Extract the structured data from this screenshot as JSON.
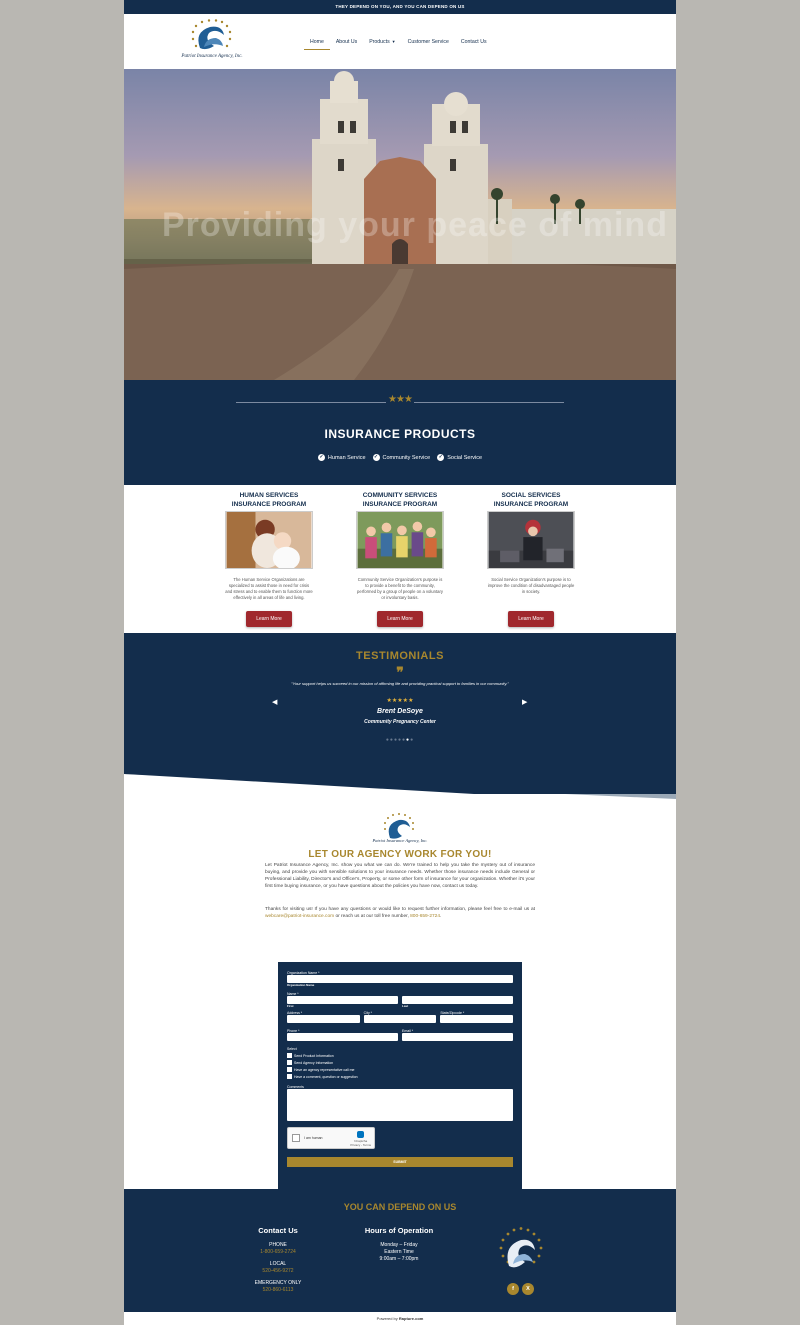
{
  "topbar": {
    "text": "THEY DEPEND ON YOU, AND YOU CAN DEPEND ON US"
  },
  "brand": {
    "name": "Patriot Insurance Agency, Inc."
  },
  "nav": {
    "items": [
      {
        "label": "Home"
      },
      {
        "label": "About Us"
      },
      {
        "label": "Products"
      },
      {
        "label": "Customer Service"
      },
      {
        "label": "Contact Us"
      }
    ],
    "active": "Home"
  },
  "hero": {
    "tagline": "Providing your peace of mind"
  },
  "products_band": {
    "title": "INSURANCE PRODUCTS",
    "checks": [
      "Human Service",
      "Community Service",
      "Social Service"
    ]
  },
  "cards": [
    {
      "title_1": "HUMAN SERVICES",
      "title_2": "INSURANCE PROGRAM",
      "desc": "The Human Service Organizations are specialized to assist those in need for crisis and stress and to enable them to function more effectively in all areas of life and living.",
      "button": "Learn More"
    },
    {
      "title_1": "COMMUNITY SERVICES",
      "title_2": "INSURANCE PROGRAM",
      "desc": "Community Service Organization's purpose is to provide a benefit to the community, performed by a group of people on a voluntary or involuntary basis.",
      "button": "Learn More"
    },
    {
      "title_1": "SOCIAL SERVICES",
      "title_2": "INSURANCE PROGRAM",
      "desc": "Social Service Organization's purpose is to improve the condition of disadvantaged people in society.",
      "button": "Learn More"
    }
  ],
  "testimonials": {
    "title": "TESTIMONIALS",
    "quote": "\"Your support helps us succeed in our mission of affirming life and providing practical support to families in our community.\"",
    "stars": "★★★★★",
    "rating": 5,
    "author": "Brent DeSoye",
    "org": "Community Pregnancy Center",
    "slide_count": 7,
    "active_slide": 6
  },
  "agency": {
    "title": "LET OUR AGENCY WORK FOR YOU!",
    "p1": "Let Patriot Insurance Agency, Inc. show you what we can do. We're trained to help you take the mystery out of insurance buying, and provide you with sensible solutions to your insurance needs. Whether those insurance needs include General or Professional Liability, Director's and Officer's, Property, or some other form of insurance for your organization. Whether it's your first time buying insurance, or you have questions about the policies you have now, contact us today.",
    "p2_a": "Thanks for visiting us! If you have any questions or would like to request further information, please feel free to e-mail us at ",
    "email": "webcare@patriot-insurance.com",
    "p2_b": " or reach us at our toll free number, ",
    "phone": "800-659-2724",
    "p2_c": "."
  },
  "form": {
    "org_label": "Organization Name *",
    "org_sub": "Organization Name",
    "name_label": "Name *",
    "first": "First",
    "last": "Last",
    "address_label": "Address *",
    "city_label": "City *",
    "state_label": "State/Zipcode *",
    "phone_label": "Phone *",
    "email_label": "Email *",
    "select_label": "Select",
    "options": [
      "Send Product Information",
      "Send Agency Information",
      "Have an agency representative call me",
      "Have a comment, question or suggestion"
    ],
    "comments_label": "Comments",
    "captcha_label": "I am human",
    "captcha_brand": "hCaptcha",
    "captcha_sub": "Privacy - Terms",
    "submit": "SUBMIT"
  },
  "footer": {
    "title": "YOU CAN DEPEND ON US",
    "contact_title": "Contact Us",
    "phone_label": "PHONE",
    "phone": "1-800-659-2724",
    "local_label": "LOCAL",
    "local": "520-456-9272",
    "emergency_label": "EMERGENCY ONLY",
    "emergency": "520-860-6113",
    "hours_title": "Hours of Operation",
    "hours_days": "Monday – Friday",
    "hours_zone": "Eastern Time",
    "hours_time": "9:00am – 7:00pm",
    "social": [
      "f",
      "X"
    ]
  },
  "powered": {
    "prefix": "Powered by ",
    "brand": "Rapture.com"
  },
  "colors": {
    "navy": "#132d4c",
    "gold": "#a8872e",
    "red": "#a0282d"
  }
}
